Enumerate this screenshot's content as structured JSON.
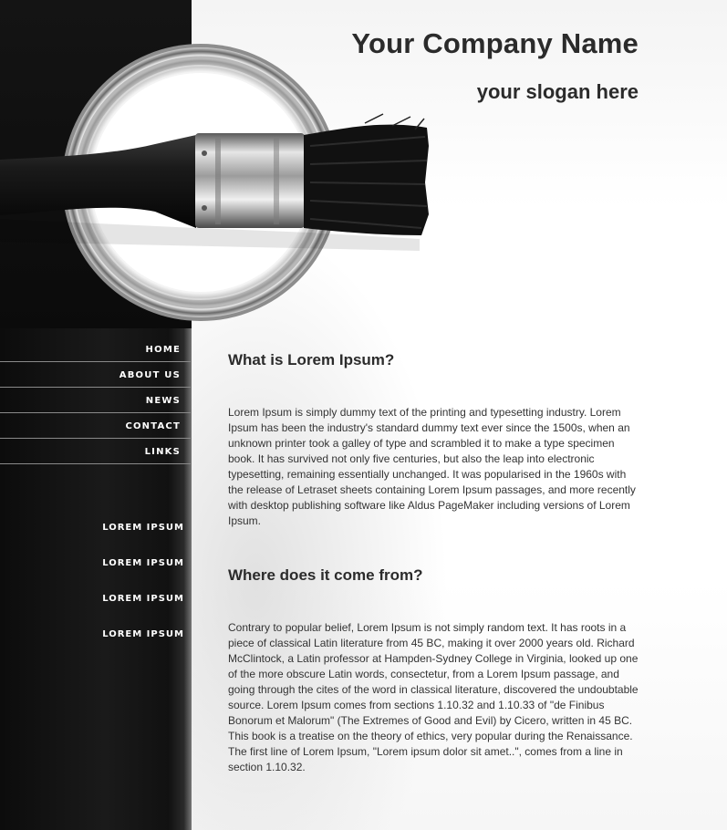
{
  "header": {
    "company_name": "Your Company Name",
    "slogan": "your slogan here"
  },
  "nav": {
    "items": [
      {
        "label": "HOME"
      },
      {
        "label": "ABOUT US"
      },
      {
        "label": "NEWS"
      },
      {
        "label": "CONTACT"
      },
      {
        "label": "LINKS"
      }
    ]
  },
  "side_links": [
    {
      "label": "LOREM IPSUM"
    },
    {
      "label": "LOREM IPSUM"
    },
    {
      "label": "LOREM IPSUM"
    },
    {
      "label": "LOREM IPSUM"
    }
  ],
  "content": {
    "sections": [
      {
        "heading": "What is Lorem Ipsum?",
        "body": "Lorem Ipsum is simply dummy text of the printing and typesetting industry. Lorem Ipsum has been the industry's standard dummy text ever since the 1500s, when an unknown printer took a galley of type and scrambled it to make a type specimen book. It has survived not only five centuries, but also the leap into electronic typesetting, remaining essentially unchanged. It was popularised in the 1960s with the release of Letraset sheets containing Lorem Ipsum passages, and more recently with desktop publishing software like Aldus PageMaker including versions of Lorem Ipsum."
      },
      {
        "heading": "Where does it come from?",
        "body": "Contrary to popular belief, Lorem Ipsum is not simply random text. It has roots in a piece of classical Latin literature from 45 BC, making it over 2000 years old. Richard McClintock, a Latin professor at Hampden-Sydney College in Virginia, looked up one of the more obscure Latin words, consectetur, from a Lorem Ipsum passage, and going through the cites of the word in classical literature, discovered the undoubtable source. Lorem Ipsum comes from sections 1.10.32 and 1.10.33 of \"de Finibus Bonorum et Malorum\" (The Extremes of Good and Evil) by Cicero, written in 45 BC. This book is a treatise on the theory of ethics, very popular during the Renaissance. The first line of Lorem Ipsum, \"Lorem ipsum dolor sit amet..\", comes from a line in section 1.10.32."
      }
    ]
  },
  "colors": {
    "sidebar_bg": "#111111",
    "heading_text": "#2b2b2b",
    "body_text": "#333333",
    "nav_text": "#ffffff"
  },
  "icons": [
    "paint-can-with-brush-image"
  ]
}
